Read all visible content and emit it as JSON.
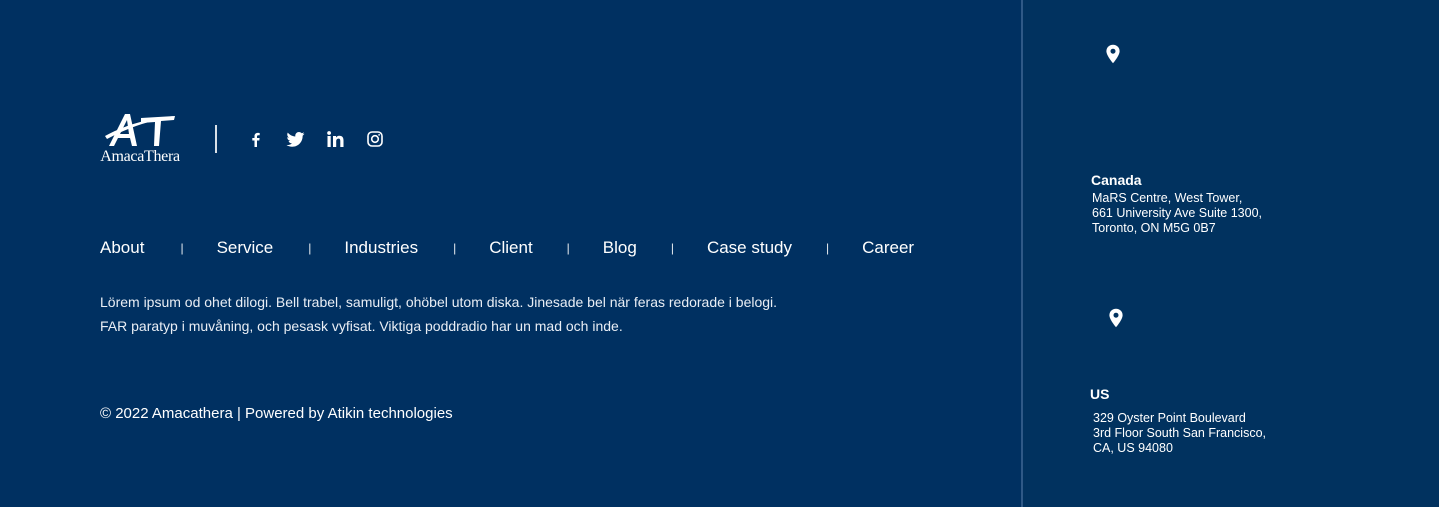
{
  "brand": {
    "logo_text": "AmacaThera"
  },
  "social": [
    {
      "name": "facebook"
    },
    {
      "name": "twitter"
    },
    {
      "name": "linkedin"
    },
    {
      "name": "instagram"
    }
  ],
  "nav": {
    "items": [
      "About",
      "Service",
      "Industries",
      "Client",
      "Blog",
      "Case study",
      "Career"
    ],
    "separator": "|"
  },
  "description": {
    "line1": "Lörem ipsum od ohet dilogi. Bell trabel, samuligt, ohöbel utom diska. Jinesade bel när feras redorade i belogi.",
    "line2": "FAR paratyp i muvåning, och pesask vyfisat. Viktiga poddradio har un mad och inde."
  },
  "copyright": "© 2022 Amacathera | Powered by Atikin technologies",
  "locations": [
    {
      "country": "Canada",
      "address": [
        "MaRS Centre, West Tower,",
        "661 University Ave Suite 1300,",
        "Toronto, ON M5G 0B7"
      ]
    },
    {
      "country": "US",
      "address": [
        "329 Oyster Point Boulevard",
        "3rd Floor South San Francisco,",
        "CA, US 94080"
      ]
    }
  ],
  "colors": {
    "background": "#003061",
    "text": "#ffffff",
    "divider": "#2f5987"
  }
}
